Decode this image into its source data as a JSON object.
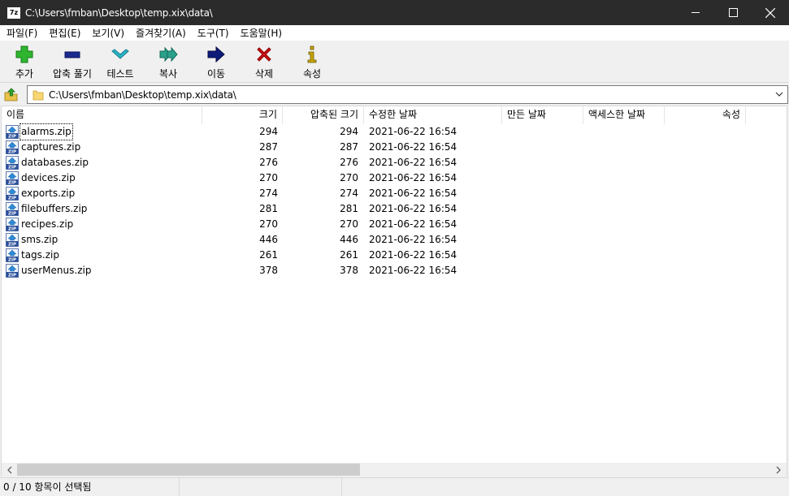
{
  "window": {
    "app_icon_text": "7z",
    "title": "C:\\Users\\fmban\\Desktop\\temp.xix\\data\\"
  },
  "menu": [
    "파일(F)",
    "편집(E)",
    "보기(V)",
    "즐겨찾기(A)",
    "도구(T)",
    "도움말(H)"
  ],
  "toolbar": {
    "add": "추가",
    "extract": "압축 풀기",
    "test": "테스트",
    "copy": "복사",
    "move": "이동",
    "delete": "삭제",
    "info": "속성"
  },
  "address": {
    "path": "C:\\Users\\fmban\\Desktop\\temp.xix\\data\\"
  },
  "columns": {
    "name": "이름",
    "size": "크기",
    "packed": "압축된 크기",
    "modified": "수정한 날짜",
    "created": "만든 날짜",
    "accessed": "액세스한 날짜",
    "attributes": "속성"
  },
  "files": [
    {
      "name": "alarms.zip",
      "size": "294",
      "packed": "294",
      "modified": "2021-06-22 16:54"
    },
    {
      "name": "captures.zip",
      "size": "287",
      "packed": "287",
      "modified": "2021-06-22 16:54"
    },
    {
      "name": "databases.zip",
      "size": "276",
      "packed": "276",
      "modified": "2021-06-22 16:54"
    },
    {
      "name": "devices.zip",
      "size": "270",
      "packed": "270",
      "modified": "2021-06-22 16:54"
    },
    {
      "name": "exports.zip",
      "size": "274",
      "packed": "274",
      "modified": "2021-06-22 16:54"
    },
    {
      "name": "filebuffers.zip",
      "size": "281",
      "packed": "281",
      "modified": "2021-06-22 16:54"
    },
    {
      "name": "recipes.zip",
      "size": "270",
      "packed": "270",
      "modified": "2021-06-22 16:54"
    },
    {
      "name": "sms.zip",
      "size": "446",
      "packed": "446",
      "modified": "2021-06-22 16:54"
    },
    {
      "name": "tags.zip",
      "size": "261",
      "packed": "261",
      "modified": "2021-06-22 16:54"
    },
    {
      "name": "userMenus.zip",
      "size": "378",
      "packed": "378",
      "modified": "2021-06-22 16:54"
    }
  ],
  "status": {
    "selection": "0 / 10 항목이 선택됨"
  },
  "icons": {
    "add": "plus-icon",
    "extract": "minus-icon",
    "test": "check-icon",
    "copy": "double-arrow-icon",
    "move": "arrow-right-icon",
    "delete": "x-icon",
    "info": "info-icon",
    "file": "zip-file-icon"
  },
  "colors": {
    "titlebar": "#2b2b2b",
    "add": "#2fb52f",
    "extract": "#1b2a8c",
    "test": "#2bb6c8",
    "copy": "#2aa08a",
    "move": "#0f1b7a",
    "delete": "#d01010",
    "info": "#c8a400"
  }
}
